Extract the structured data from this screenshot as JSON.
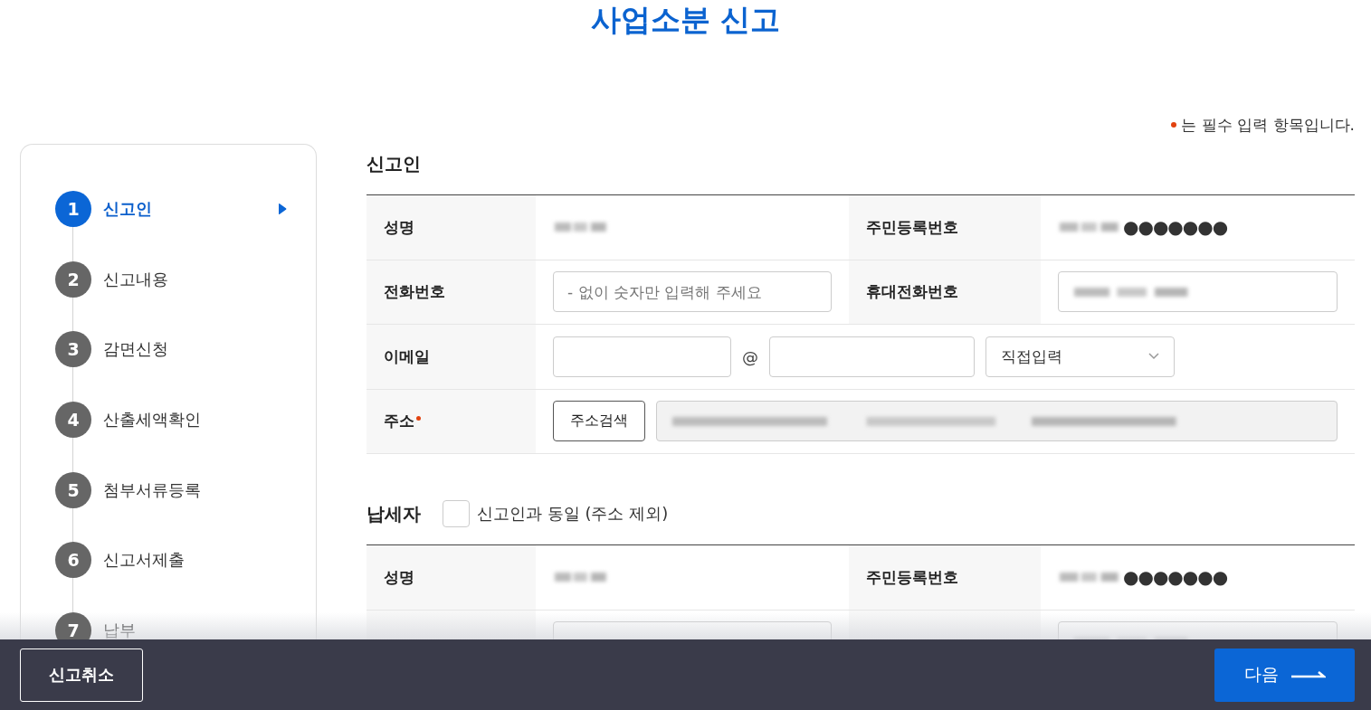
{
  "title": "사업소분 신고",
  "required_note": "는 필수 입력 항목입니다.",
  "steps": [
    {
      "number": "1",
      "label": "신고인",
      "selected": true
    },
    {
      "number": "2",
      "label": "신고내용",
      "selected": false
    },
    {
      "number": "3",
      "label": "감면신청",
      "selected": false
    },
    {
      "number": "4",
      "label": "산출세액확인",
      "selected": false
    },
    {
      "number": "5",
      "label": "첨부서류등록",
      "selected": false
    },
    {
      "number": "6",
      "label": "신고서제출",
      "selected": false
    },
    {
      "number": "7",
      "label": "납부",
      "selected": false
    }
  ],
  "sections": [
    {
      "title": "신고인",
      "rows": [
        {
          "cells": [
            {
              "kind": "label",
              "text": "성명",
              "required": false
            },
            {
              "kind": "redacted"
            },
            {
              "kind": "label",
              "text": "주민등록번호",
              "required": false
            },
            {
              "kind": "masked",
              "text": "●●●●●●●"
            }
          ]
        },
        {
          "cells": [
            {
              "kind": "label",
              "text": "전화번호",
              "required": false
            },
            {
              "kind": "input",
              "placeholder": "- 없이 숫자만 입력해 주세요"
            },
            {
              "kind": "label",
              "text": "휴대전화번호",
              "required": false
            },
            {
              "kind": "redacted_input"
            }
          ]
        },
        {
          "cells": [
            {
              "kind": "label",
              "text": "이메일",
              "required": false
            },
            {
              "kind": "email",
              "colspan": 3,
              "at": "@",
              "select": "직접입력"
            }
          ]
        },
        {
          "cells": [
            {
              "kind": "label",
              "text": "주소",
              "required": true
            },
            {
              "kind": "address",
              "colspan": 3,
              "button": "주소검색"
            }
          ]
        }
      ]
    },
    {
      "title": "납세자",
      "same_as": {
        "label": "신고인과 동일 (주소 제외)",
        "checked": false
      },
      "rows": [
        {
          "cells": [
            {
              "kind": "label",
              "text": "성명",
              "required": false
            },
            {
              "kind": "redacted"
            },
            {
              "kind": "label",
              "text": "주민등록번호",
              "required": false
            },
            {
              "kind": "masked",
              "text": "●●●●●●●"
            }
          ]
        },
        {
          "cells": [
            {
              "kind": "blank_label"
            },
            {
              "kind": "blank_input"
            },
            {
              "kind": "blank_label"
            },
            {
              "kind": "redacted_input"
            }
          ]
        }
      ]
    }
  ],
  "footer": {
    "cancel": "신고취소",
    "next": "다음"
  }
}
